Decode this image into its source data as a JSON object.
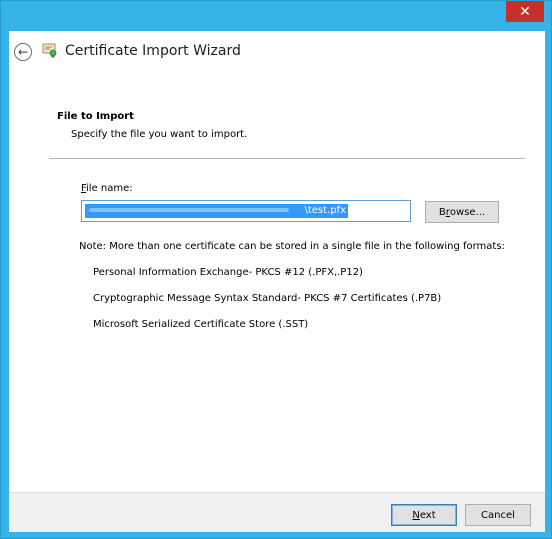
{
  "window": {
    "close_glyph": "✕"
  },
  "header": {
    "back_glyph": "←",
    "title": "Certificate Import Wizard"
  },
  "section": {
    "title": "File to Import",
    "subtitle": "Specify the file you want to import."
  },
  "file_field": {
    "label_accel": "F",
    "label_rest": "ile name:",
    "value": "\\test.pfx"
  },
  "browse": {
    "label_pre": "B",
    "label_accel": "r",
    "label_rest": "owse..."
  },
  "note": "Note:  More than one certificate can be stored in a single file in the following formats:",
  "formats": [
    "Personal Information Exchange- PKCS #12 (.PFX,.P12)",
    "Cryptographic Message Syntax Standard- PKCS #7 Certificates (.P7B)",
    "Microsoft Serialized Certificate Store (.SST)"
  ],
  "footer": {
    "next_accel": "N",
    "next_rest": "ext",
    "cancel_label": "Cancel"
  },
  "colors": {
    "frame": "#33b3e8",
    "close": "#c7302a",
    "selection": "#3399ff"
  }
}
